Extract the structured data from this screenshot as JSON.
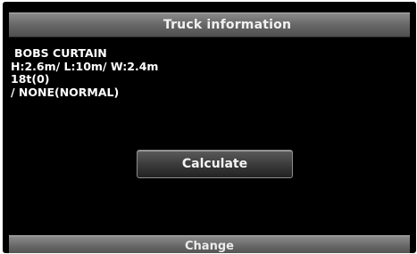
{
  "header": {
    "title": "Truck information"
  },
  "truck_info": {
    "name": "BOBS CURTAIN",
    "dimensions": "H:2.6m/ L:10m/ W:2.4m",
    "weight": "18t(0)",
    "hazard": "/ NONE(NORMAL)"
  },
  "actions": {
    "calculate_label": "Calculate",
    "change_label": "Change"
  }
}
